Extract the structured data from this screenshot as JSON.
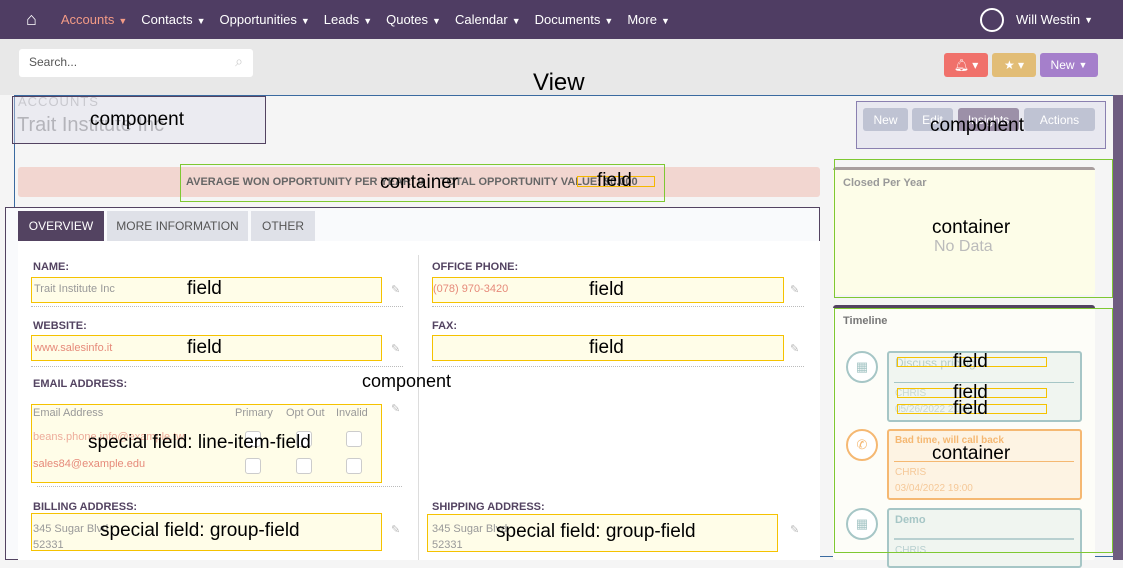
{
  "nav": {
    "home_icon": "home-icon",
    "items": [
      {
        "label": "Accounts",
        "active": true
      },
      {
        "label": "Contacts"
      },
      {
        "label": "Opportunities"
      },
      {
        "label": "Leads"
      },
      {
        "label": "Quotes"
      },
      {
        "label": "Calendar"
      },
      {
        "label": "Documents"
      },
      {
        "label": "More"
      }
    ],
    "user": "Will Westin",
    "user_icon": "user-circle-icon"
  },
  "header": {
    "search_placeholder": "Search...",
    "search_icon": "search-icon",
    "bell_icon": "bell-icon",
    "star_icon": "star-icon",
    "new_label": "New"
  },
  "record": {
    "module": "ACCOUNTS",
    "title": "Trait Institute Inc",
    "buttons": {
      "new": "New",
      "edit": "Edit",
      "insights": "Insights",
      "actions": "Actions"
    }
  },
  "banner": {
    "text1": "AVERAGE WON OPPORTUNITY PER YEAR: 0",
    "text2": "TOTAL OPPORTUNITY VALUE: $0.000"
  },
  "tabs": [
    "OVERVIEW",
    "MORE INFORMATION",
    "OTHER"
  ],
  "fields": {
    "name_label": "NAME:",
    "name": "Trait Institute Inc",
    "phone_label": "OFFICE PHONE:",
    "phone": "(078) 970-3420",
    "website_label": "WEBSITE:",
    "website": "www.salesinfo.it",
    "fax_label": "FAX:",
    "email_label": "EMAIL ADDRESS:",
    "email_cols": [
      "Email Address",
      "Primary",
      "Opt Out",
      "Invalid"
    ],
    "emails": [
      "beans.phone.info@example.tw",
      "sales84@example.edu"
    ],
    "billing_label": "BILLING ADDRESS:",
    "billing": [
      "345 Sugar Blvd",
      "52331"
    ],
    "shipping_label": "SHIPPING ADDRESS:",
    "shipping": [
      "345 Sugar Blvd",
      "52331"
    ]
  },
  "sidebar": {
    "closed_title": "Closed Per Year",
    "no_data": "No Data",
    "timeline_title": "Timeline",
    "items": [
      {
        "title": "Discuss pricing",
        "user": "CHRIS",
        "date": "05/26/2022 21:00",
        "icon": "calendar-icon"
      },
      {
        "title": "Bad time, will call back",
        "user": "CHRIS",
        "date": "03/04/2022 19:00",
        "icon": "phone-icon"
      },
      {
        "title": "Demo",
        "user": "CHRIS",
        "icon": "calendar-icon"
      }
    ]
  },
  "annotations": {
    "view": "View",
    "component": "component",
    "container": "container",
    "field": "field",
    "line_item": "special field: line-item-field",
    "group": "special field: group-field"
  },
  "colors": {
    "nav": "#4f3d63",
    "accent": "#f39b86",
    "bell": "#f0716b",
    "star": "#e2bd76",
    "new": "#a57fcb"
  }
}
